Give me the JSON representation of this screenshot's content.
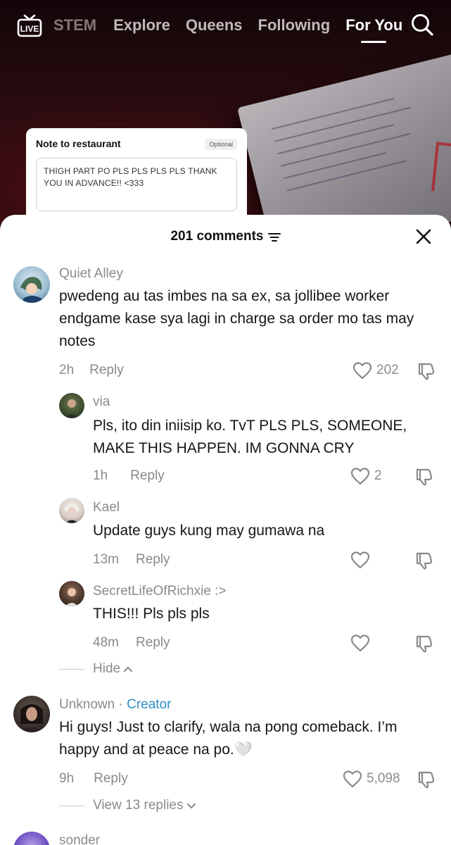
{
  "nav": {
    "live_label": "LIVE",
    "tabs": [
      "STEM",
      "Explore",
      "Queens",
      "Following",
      "For You"
    ],
    "active_tab": "For You"
  },
  "note_card": {
    "title": "Note to restaurant",
    "optional": "Optional",
    "text": "THIGH PART PO PLS PLS PLS PLS THANK YOU IN ADVANCE!! <333"
  },
  "comments_sheet": {
    "title": "201 comments",
    "comments": [
      {
        "user": "Quiet Alley",
        "text": "pwedeng au tas imbes na sa ex, sa jollibee worker endgame kase sya lagi in charge sa order mo tas may notes",
        "time": "2h",
        "reply": "Reply",
        "likes": "202"
      },
      {
        "user": "via",
        "text": "Pls, ito din iniisip ko. TvT PLS PLS, SOMEONE, MAKE THIS HAPPEN. IM GONNA CRY",
        "time": "1h",
        "reply": "Reply",
        "likes": "2"
      },
      {
        "user": "Kael",
        "text": "Update guys kung may gumawa na",
        "time": "13m",
        "reply": "Reply",
        "likes": ""
      },
      {
        "user": "SecretLifeOfRichxie :>",
        "text": "THIS!!! Pls pls pls",
        "time": "48m",
        "reply": "Reply",
        "likes": ""
      },
      {
        "user": "Unknown",
        "creator_tag": "Creator",
        "text": "Hi guys! Just to clarify, wala na pong comeback. I’m happy and at peace na po.🤍",
        "time": "9h",
        "reply": "Reply",
        "likes": "5,098"
      },
      {
        "user": "sonder"
      }
    ],
    "hide_label": "Hide",
    "view_replies_label": "View 13 replies"
  },
  "colors": {
    "creator": "#2b8fc4",
    "meta_gray": "#8a8a8a",
    "sheet_bg": "#ffffff"
  }
}
